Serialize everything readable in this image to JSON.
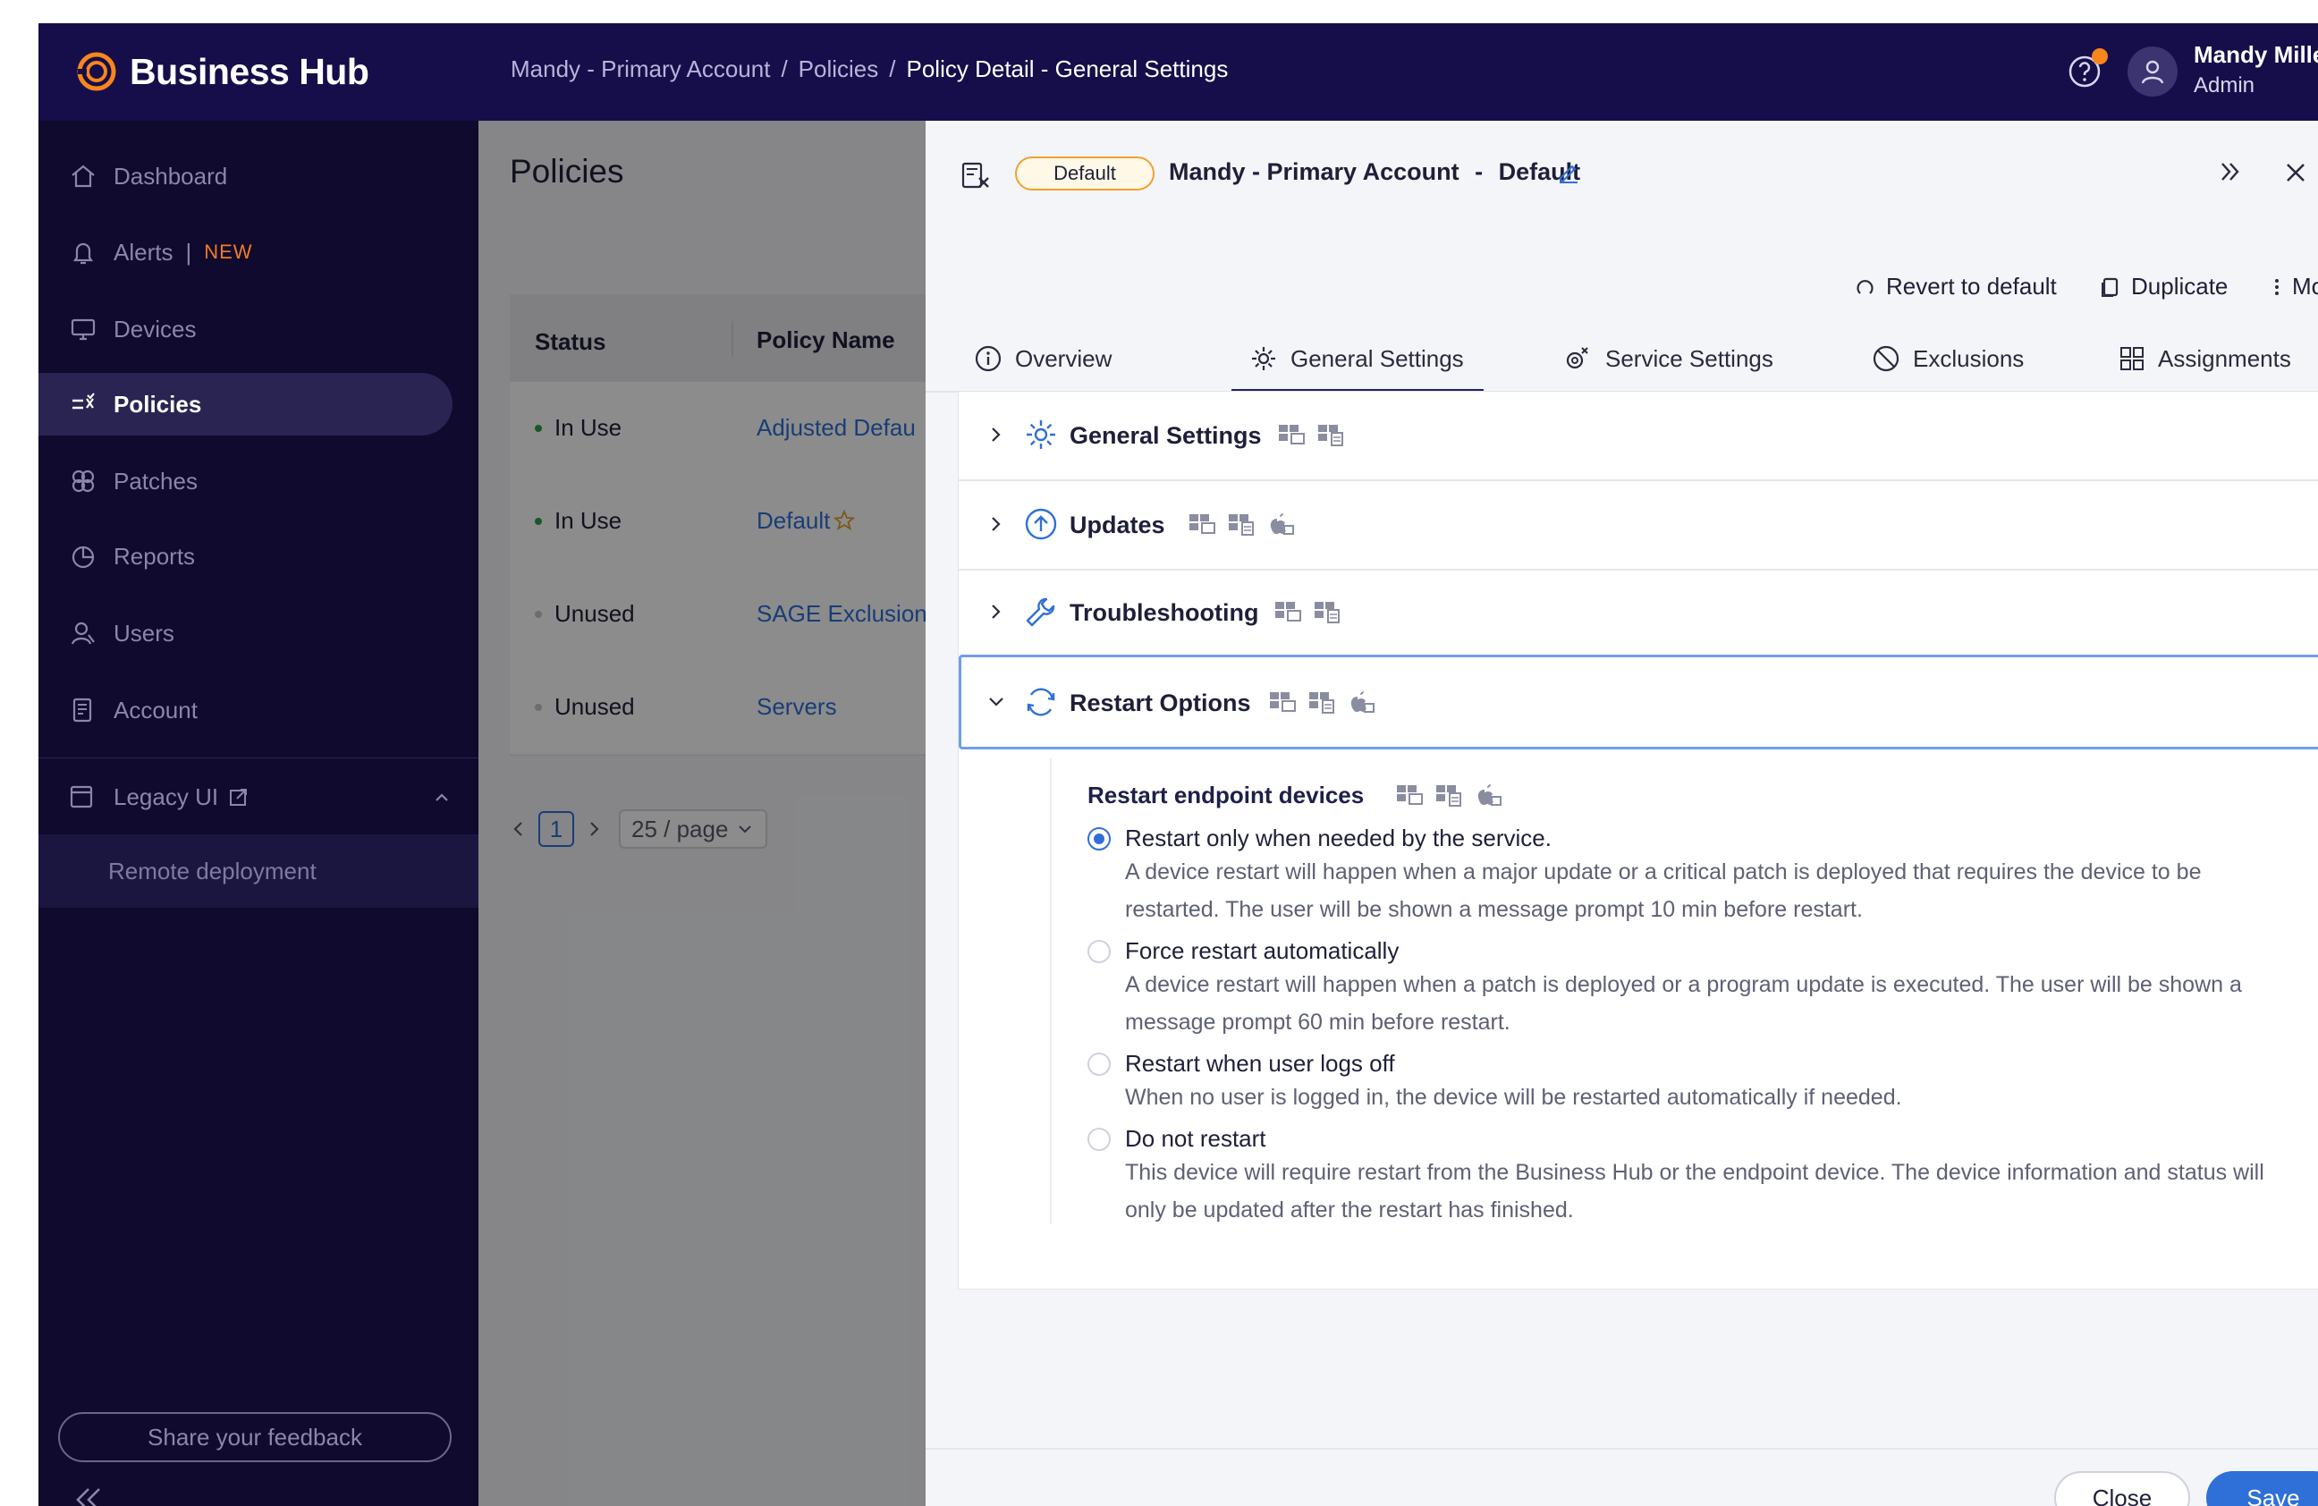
{
  "header": {
    "app_name": "Business Hub",
    "breadcrumbs": [
      "Mandy - Primary Account",
      "Policies",
      "Policy Detail - General Settings"
    ],
    "user_name": "Mandy Mille",
    "user_role": "Admin"
  },
  "sidebar": {
    "items": [
      {
        "label": "Dashboard",
        "icon": "home-icon"
      },
      {
        "label": "Alerts",
        "icon": "bell-icon",
        "badge": "NEW"
      },
      {
        "label": "Devices",
        "icon": "monitor-icon"
      },
      {
        "label": "Policies",
        "icon": "policies-icon",
        "active": true
      },
      {
        "label": "Patches",
        "icon": "patches-icon"
      },
      {
        "label": "Reports",
        "icon": "pie-chart-icon"
      },
      {
        "label": "Users",
        "icon": "users-icon"
      },
      {
        "label": "Account",
        "icon": "account-icon"
      }
    ],
    "new_separator": "|",
    "legacy_label": "Legacy UI",
    "legacy_subitem": "Remote deployment",
    "feedback_label": "Share your feedback"
  },
  "policies": {
    "title": "Policies",
    "columns": [
      "Status",
      "Policy Name"
    ],
    "rows": [
      {
        "status": "In Use",
        "name": "Adjusted Defau"
      },
      {
        "status": "In Use",
        "name": "Default"
      },
      {
        "status": "Unused",
        "name": "SAGE Exclusion"
      },
      {
        "status": "Unused",
        "name": "Servers"
      }
    ],
    "page": "1",
    "page_size": "25 / page",
    "colors": {
      "in_use": "#2e9e4f",
      "unused": "#c4c6cf"
    }
  },
  "drawer": {
    "badge": "Default",
    "account": "Mandy - Primary Account",
    "title_sep": "-",
    "policy": "Default",
    "actions": {
      "revert": "Revert to default",
      "duplicate": "Duplicate",
      "more": "More"
    },
    "tabs": [
      "Overview",
      "General Settings",
      "Service Settings",
      "Exclusions",
      "Assignments"
    ],
    "active_tab": "General Settings",
    "sections": [
      {
        "title": "General Settings",
        "icon": "gear-icon"
      },
      {
        "title": "Updates",
        "icon": "arrow-up-circle-icon"
      },
      {
        "title": "Troubleshooting",
        "icon": "wrench-icon"
      },
      {
        "title": "Restart Options",
        "icon": "refresh-icon",
        "expanded": true
      }
    ],
    "restart": {
      "heading": "Restart endpoint devices",
      "options": [
        {
          "label": "Restart only when needed by the service.",
          "selected": true,
          "desc": "A device restart will happen when a major update or a critical patch is deployed that requires the device to be restarted. The user will be shown a message prompt 10 min before restart."
        },
        {
          "label": "Force restart automatically",
          "selected": false,
          "desc": "A device restart will happen when a patch is deployed or a program update is executed. The user will be shown a message prompt 60 min before restart."
        },
        {
          "label": "Restart when user logs off",
          "selected": false,
          "desc": "When no user is logged in, the device will be restarted automatically if needed."
        },
        {
          "label": "Do not restart",
          "selected": false,
          "desc": "This device will require restart from the Business Hub or the endpoint device. The device information and status will only be updated after the restart has finished."
        }
      ]
    },
    "footer": {
      "close": "Close",
      "save": "Save"
    },
    "accent": "#2f6fd8"
  }
}
